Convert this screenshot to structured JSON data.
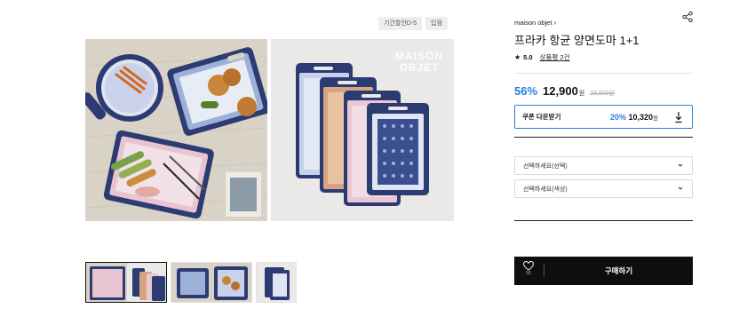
{
  "badges": [
    "기간할인D-5",
    "입점"
  ],
  "watermark": {
    "line1": "MAISON",
    "line2": "OBJET"
  },
  "product": {
    "brand": "maison objet",
    "brand_chevron": "›",
    "title": "프라카 항균 양면도마 1+1",
    "rating_star": "★",
    "rating": "5.0",
    "review_link": "상품평 2건"
  },
  "price": {
    "discount": "56%",
    "sale": "12,900",
    "won": "원",
    "original": "29,900원"
  },
  "coupon": {
    "label": "쿠폰 다운받기",
    "percent": "20%",
    "price": "10,320",
    "won": "원"
  },
  "options": {
    "select1": "선택하세요(선택)",
    "select2": "선택하세요(색상)"
  },
  "purchase": {
    "wish_count": "55",
    "buy_label": "구매하기"
  },
  "colors": {
    "accent": "#2a7de1",
    "buy_bar": "#0e0e0e",
    "board_navy": "#2d3b73"
  },
  "icons": [
    "share-icon",
    "star-icon",
    "download-icon",
    "chevron-down-icon",
    "heart-icon"
  ]
}
